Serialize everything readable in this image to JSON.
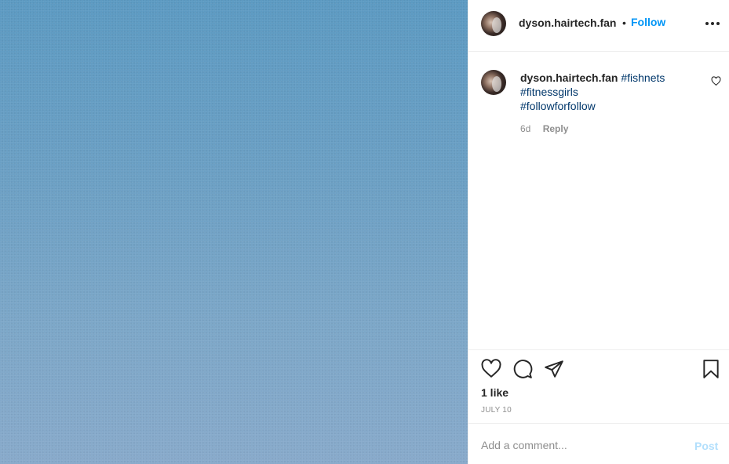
{
  "post": {
    "username": "dyson.hairtech.fan",
    "separator": "•",
    "follow_label": "Follow"
  },
  "comment": {
    "username": "dyson.hairtech.fan",
    "hashtags": [
      "#fishnets",
      "#fitnessgirls",
      "#followforfollow"
    ],
    "age": "6d",
    "reply_label": "Reply"
  },
  "engagement": {
    "likes": "1 like",
    "date": "JULY 10"
  },
  "add_comment": {
    "placeholder": "Add a comment...",
    "post_label": "Post"
  },
  "icons": {
    "more": "more-options-icon",
    "like": "heart-icon",
    "comment": "comment-icon",
    "share": "send-icon",
    "save": "bookmark-icon",
    "comment_like": "small-heart-icon"
  },
  "colors": {
    "media_background": "#6a9fc4",
    "follow_blue": "#0095f6",
    "hashtag_blue": "#00376b",
    "post_disabled": "#b2dffc",
    "muted_text": "#8e8e8e"
  }
}
